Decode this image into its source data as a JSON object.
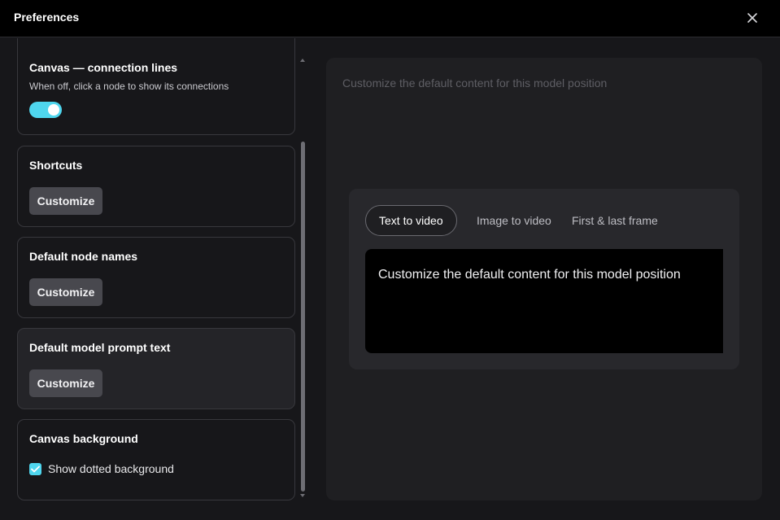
{
  "window": {
    "title": "Preferences"
  },
  "settings": {
    "connection_lines": {
      "title": "Canvas — connection lines",
      "description": "When off, click a node to show its connections",
      "enabled": true
    },
    "shortcuts": {
      "title": "Shortcuts",
      "button": "Customize"
    },
    "node_names": {
      "title": "Default node names",
      "button": "Customize"
    },
    "prompt_text": {
      "title": "Default model prompt text",
      "button": "Customize"
    },
    "canvas_background": {
      "title": "Canvas background",
      "checkbox_label": "Show dotted background",
      "checked": true
    }
  },
  "detail": {
    "hint": "Customize the default content for this model position",
    "tabs": [
      {
        "label": "Text to video",
        "active": true
      },
      {
        "label": "Image to video",
        "active": false
      },
      {
        "label": "First & last frame",
        "active": false
      }
    ],
    "content": "Customize the default content for this model position"
  },
  "colors": {
    "accent": "#4fd6ee",
    "background": "#17171a",
    "panel": "#1f1f22",
    "titlebar": "#000000"
  },
  "icons": {
    "close": "close-icon",
    "check": "check-icon",
    "scroll_up": "arrow-up-icon",
    "scroll_down": "arrow-down-icon"
  }
}
